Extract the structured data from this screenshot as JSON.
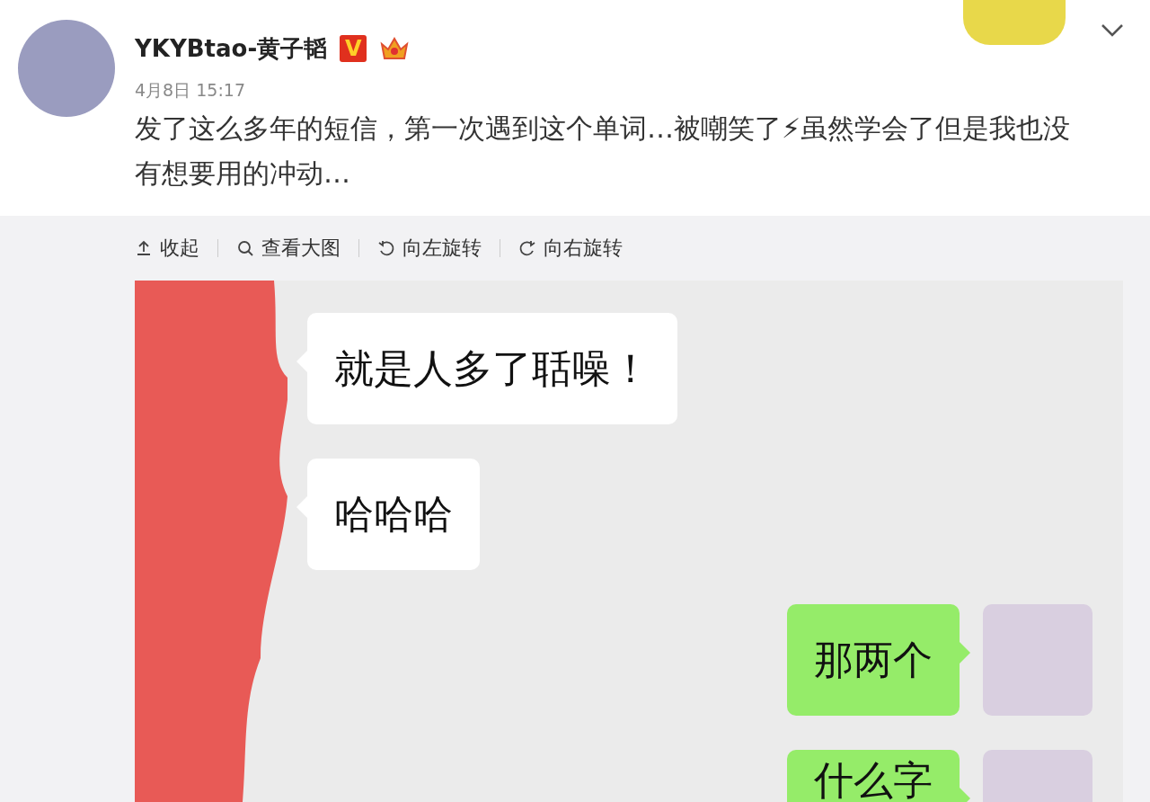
{
  "post": {
    "author": "YKYBtao-黄子韬",
    "verified_badge": "V",
    "date": "4月8日 15:17",
    "text": "发了这么多年的短信，第一次遇到这个单词…被嘲笑了⚡虽然学会了但是我也没有想要用的冲动…"
  },
  "toolbar": [
    {
      "kind": "collapse",
      "label": "收起"
    },
    {
      "kind": "zoom",
      "label": "查看大图"
    },
    {
      "kind": "rotate_left",
      "label": "向左旋转"
    },
    {
      "kind": "rotate_right",
      "label": "向右旋转"
    }
  ],
  "chat": {
    "messages": [
      {
        "kind": "received",
        "text": "就是人多了聒噪！"
      },
      {
        "kind": "received",
        "text": "哈哈哈"
      },
      {
        "kind": "sent",
        "text": "那两个"
      },
      {
        "kind": "sent",
        "text": "什么字"
      }
    ]
  }
}
